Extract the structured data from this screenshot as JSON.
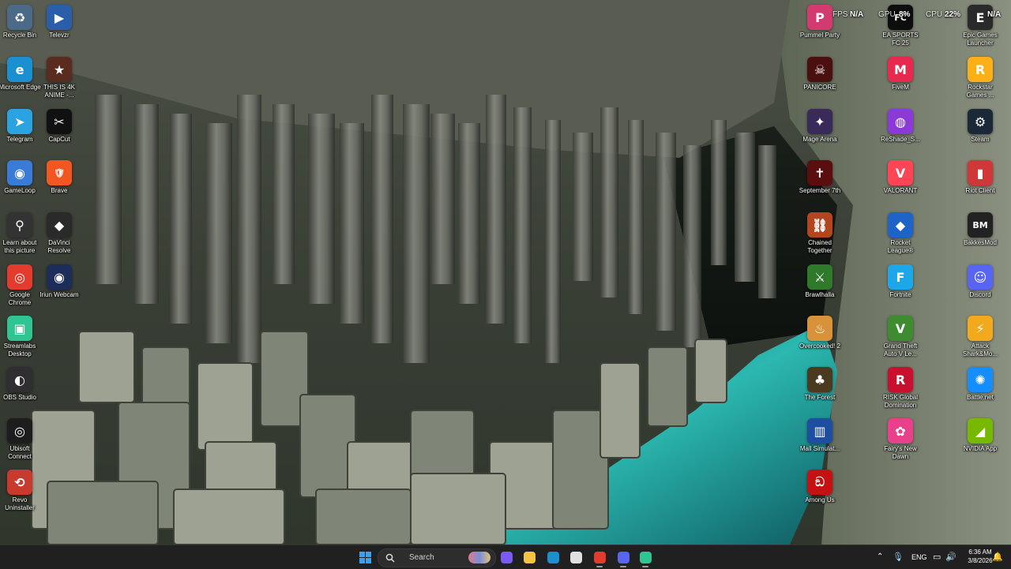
{
  "desktop_icons": [
    {
      "label": "Recycle Bin",
      "icon": "recycle-bin-icon",
      "color": "#4a6a88"
    },
    {
      "label": "Televzr",
      "icon": "televzr-icon",
      "color": "#2b5ea8"
    },
    {
      "label": "Microsoft Edge",
      "icon": "edge-icon",
      "color": "#1c8fd0"
    },
    {
      "label": "THIS IS 4K ANIME -...",
      "icon": "anime-shortcut-icon",
      "color": "#5a2b1f"
    },
    {
      "label": "Telegram",
      "icon": "telegram-icon",
      "color": "#2aa3e0"
    },
    {
      "label": "CapCut",
      "icon": "capcut-icon",
      "color": "#111111"
    },
    {
      "label": "GameLoop",
      "icon": "gameloop-icon",
      "color": "#3b7bd8"
    },
    {
      "label": "Brave",
      "icon": "brave-icon",
      "color": "#f25722"
    },
    {
      "label": "Learn about this picture",
      "icon": "learn-picture-icon",
      "color": "#333333"
    },
    {
      "label": "DaVinci Resolve",
      "icon": "davinci-resolve-icon",
      "color": "#2a2a2a"
    },
    {
      "label": "Google Chrome",
      "icon": "chrome-icon",
      "color": "#e33b2e"
    },
    {
      "label": "Iriun Webcam",
      "icon": "iriun-webcam-icon",
      "color": "#1c2d5a"
    },
    {
      "label": "Streamlabs Desktop",
      "icon": "streamlabs-icon",
      "color": "#30c493"
    },
    {
      "label": "OBS Studio",
      "icon": "obs-icon",
      "color": "#302e31"
    },
    {
      "label": "Ubisoft Connect",
      "icon": "ubisoft-icon",
      "color": "#1d1d1d"
    },
    {
      "label": "Revo Uninstaller",
      "icon": "revo-uninstaller-icon",
      "color": "#c83a2d"
    },
    {
      "label": "Pummel Party",
      "icon": "pummel-party-icon",
      "color": "#d33a6f"
    },
    {
      "label": "EA SPORTS FC 25",
      "icon": "ea-fc-icon",
      "color": "#0d0d0d"
    },
    {
      "label": "Epic Games Launcher",
      "icon": "epic-games-icon",
      "color": "#2a2a2a"
    },
    {
      "label": "PANICORE",
      "icon": "panicore-icon",
      "color": "#4a1010"
    },
    {
      "label": "FiveM",
      "icon": "fivem-icon",
      "color": "#e8294f"
    },
    {
      "label": "Rockstar Games ...",
      "icon": "rockstar-icon",
      "color": "#fcaf17"
    },
    {
      "label": "Mage Arena",
      "icon": "mage-arena-icon",
      "color": "#3a2a5a"
    },
    {
      "label": "ReShade_S...",
      "icon": "reshade-icon",
      "color": "#8b3ad8"
    },
    {
      "label": "Steam",
      "icon": "steam-icon",
      "color": "#1b2838"
    },
    {
      "label": "September 7th",
      "icon": "september-7th-icon",
      "color": "#5a0e0e"
    },
    {
      "label": "VALORANT",
      "icon": "valorant-icon",
      "color": "#fd4556"
    },
    {
      "label": "Riot Client",
      "icon": "riot-client-icon",
      "color": "#d13639"
    },
    {
      "label": "Chained Together",
      "icon": "chained-together-icon",
      "color": "#b4461f"
    },
    {
      "label": "Rocket League®",
      "icon": "rocket-league-icon",
      "color": "#1e63c8"
    },
    {
      "label": "BakkesMod",
      "icon": "bakkesmod-icon",
      "color": "#222222"
    },
    {
      "label": "Brawlhalla",
      "icon": "brawlhalla-icon",
      "color": "#2f7a2a"
    },
    {
      "label": "Fortnite",
      "icon": "fortnite-icon",
      "color": "#1ea7e8"
    },
    {
      "label": "Discord",
      "icon": "discord-icon",
      "color": "#5865f2"
    },
    {
      "label": "Overcooked! 2",
      "icon": "overcooked-icon",
      "color": "#d8923a"
    },
    {
      "label": "Grand Theft Auto V Le...",
      "icon": "gta-v-icon",
      "color": "#3e8c2f"
    },
    {
      "label": "Attack Shark&Mo...",
      "icon": "attack-shark-icon",
      "color": "#f2a91d"
    },
    {
      "label": "The Forest",
      "icon": "the-forest-icon",
      "color": "#4a3a20"
    },
    {
      "label": "RISK Global Domination",
      "icon": "risk-icon",
      "color": "#c8102e"
    },
    {
      "label": "Battle.net",
      "icon": "battlenet-icon",
      "color": "#148eff"
    },
    {
      "label": "Mall Simulat...",
      "icon": "mall-simulator-icon",
      "color": "#1e4ea0"
    },
    {
      "label": "Fairy's New Dawn",
      "icon": "fairys-new-dawn-icon",
      "color": "#e8408a"
    },
    {
      "label": "NVIDIA App",
      "icon": "nvidia-icon",
      "color": "#76b900"
    },
    {
      "label": "Among Us",
      "icon": "among-us-icon",
      "color": "#c51111"
    }
  ],
  "icon_glyphs": {
    "Recycle Bin": "♻",
    "Televzr": "▶",
    "Microsoft Edge": "e",
    "THIS IS 4K ANIME -...": "★",
    "Telegram": "➤",
    "CapCut": "✂",
    "GameLoop": "◉",
    "Brave": "🛡",
    "Learn about this picture": "⚲",
    "DaVinci Resolve": "◆",
    "Google Chrome": "◎",
    "Iriun Webcam": "◉",
    "Streamlabs Desktop": "▣",
    "OBS Studio": "◐",
    "Ubisoft Connect": "◎",
    "Revo Uninstaller": "⟲",
    "Pummel Party": "P",
    "EA SPORTS FC 25": "FC",
    "Epic Games Launcher": "E",
    "PANICORE": "☠",
    "FiveM": "M",
    "Rockstar Games ...": "R",
    "Mage Arena": "✦",
    "ReShade_S...": "◍",
    "Steam": "⚙",
    "September 7th": "✝",
    "VALORANT": "V",
    "Riot Client": "▮",
    "Chained Together": "⛓",
    "Rocket League®": "◆",
    "BakkesMod": "BM",
    "Brawlhalla": "⚔",
    "Fortnite": "F",
    "Discord": "☺",
    "Overcooked! 2": "♨",
    "Grand Theft Auto V Le...": "V",
    "Attack Shark&Mo...": "⚡",
    "The Forest": "♣",
    "RISK Global Domination": "R",
    "Battle.net": "✺",
    "Mall Simulat...": "▥",
    "Fairy's New Dawn": "✿",
    "NVIDIA App": "◢",
    "Among Us": "ඞ"
  },
  "perf_overlay": {
    "fps_label": "FPS",
    "fps_value": "N/A",
    "gpu_label": "GPU",
    "gpu_value": "8%",
    "cpu_label": "CPU",
    "cpu_value": "22%",
    "extra_value": "N/A"
  },
  "taskbar": {
    "search_placeholder": "Search",
    "pinned": [
      {
        "name": "start-button",
        "icon": "windows-logo-icon",
        "color": "#3aa0f0"
      },
      {
        "name": "copilot",
        "icon": "copilot-icon",
        "color": "#7a5af0"
      },
      {
        "name": "file-explorer",
        "icon": "folder-icon",
        "color": "#f5c342"
      },
      {
        "name": "edge",
        "icon": "edge-icon",
        "color": "#1c8fd0"
      },
      {
        "name": "microsoft-store",
        "icon": "store-icon",
        "color": "#e0e0e0"
      },
      {
        "name": "chrome",
        "icon": "chrome-icon",
        "color": "#e33b2e"
      },
      {
        "name": "discord",
        "icon": "discord-icon",
        "color": "#5865f2"
      },
      {
        "name": "streamlabs",
        "icon": "streamlabs-icon",
        "color": "#30c493"
      }
    ],
    "tray": {
      "language": "ENG",
      "time": "6:36 AM",
      "date": "3/8/2026"
    }
  }
}
